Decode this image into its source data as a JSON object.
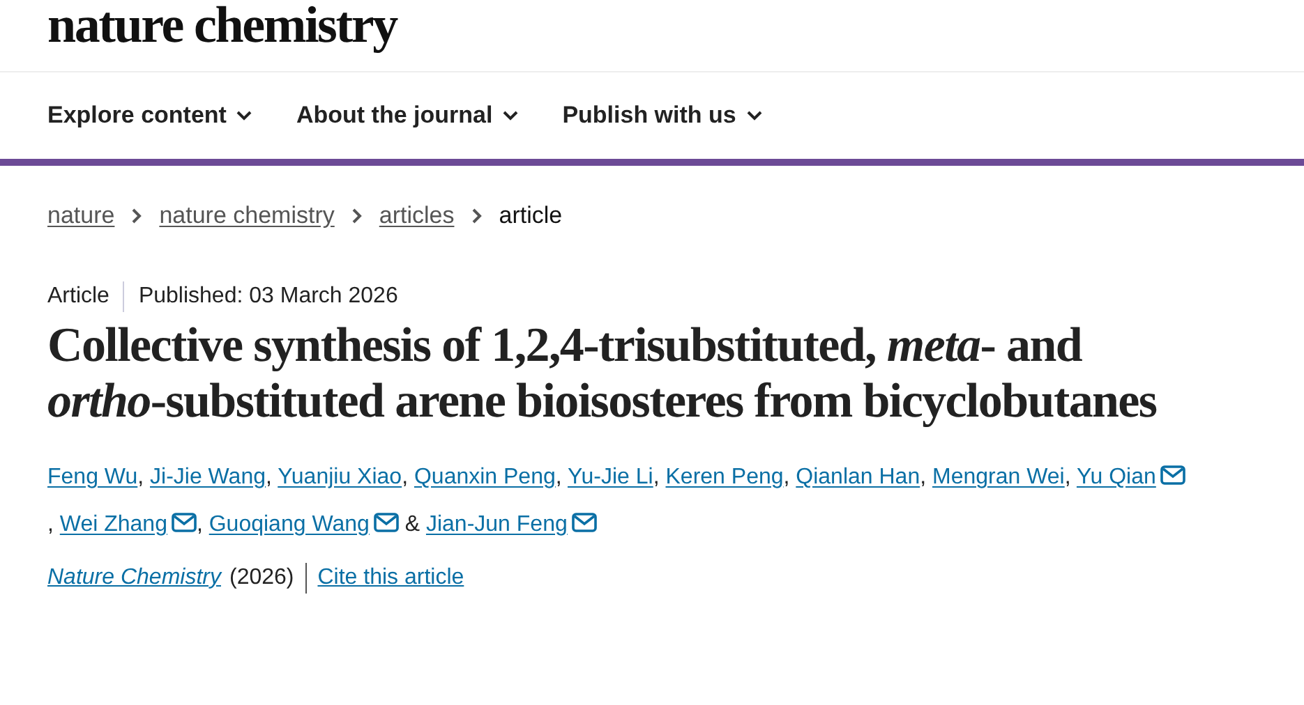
{
  "site": {
    "logo": "nature chemistry"
  },
  "nav": [
    {
      "label": "Explore content"
    },
    {
      "label": "About the journal"
    },
    {
      "label": "Publish with us"
    }
  ],
  "breadcrumb": [
    {
      "label": "nature",
      "link": true
    },
    {
      "label": "nature chemistry",
      "link": true
    },
    {
      "label": "articles",
      "link": true
    },
    {
      "label": "article",
      "link": false
    }
  ],
  "article": {
    "type": "Article",
    "published": "Published: 03 March 2026",
    "title": "Collective synthesis of 1,2,4-trisubstituted, *meta*- and *ortho*-substituted arene bioisosteres from bicyclobutanes",
    "authors": [
      {
        "name": "Feng Wu",
        "email": false,
        "separator": ", "
      },
      {
        "name": "Ji-Jie Wang",
        "email": false,
        "separator": ", "
      },
      {
        "name": "Yuanjiu Xiao",
        "email": false,
        "separator": ", "
      },
      {
        "name": "Quanxin Peng",
        "email": false,
        "separator": ", "
      },
      {
        "name": "Yu-Jie Li",
        "email": false,
        "separator": ", "
      },
      {
        "name": "Keren Peng",
        "email": false,
        "separator": ", "
      },
      {
        "name": "Qianlan Han",
        "email": false,
        "separator": ", "
      },
      {
        "name": "Mengran Wei",
        "email": false,
        "separator": ", "
      },
      {
        "name": "Yu Qian",
        "email": true,
        "separator": ", "
      },
      {
        "name": "Wei Zhang",
        "email": true,
        "separator": ", "
      },
      {
        "name": "Guoqiang Wang",
        "email": true,
        "separator": " & "
      },
      {
        "name": "Jian-Jun Feng",
        "email": true
      }
    ],
    "journal": "Nature Chemistry",
    "year": "(2026)",
    "cite": "Cite this article"
  }
}
